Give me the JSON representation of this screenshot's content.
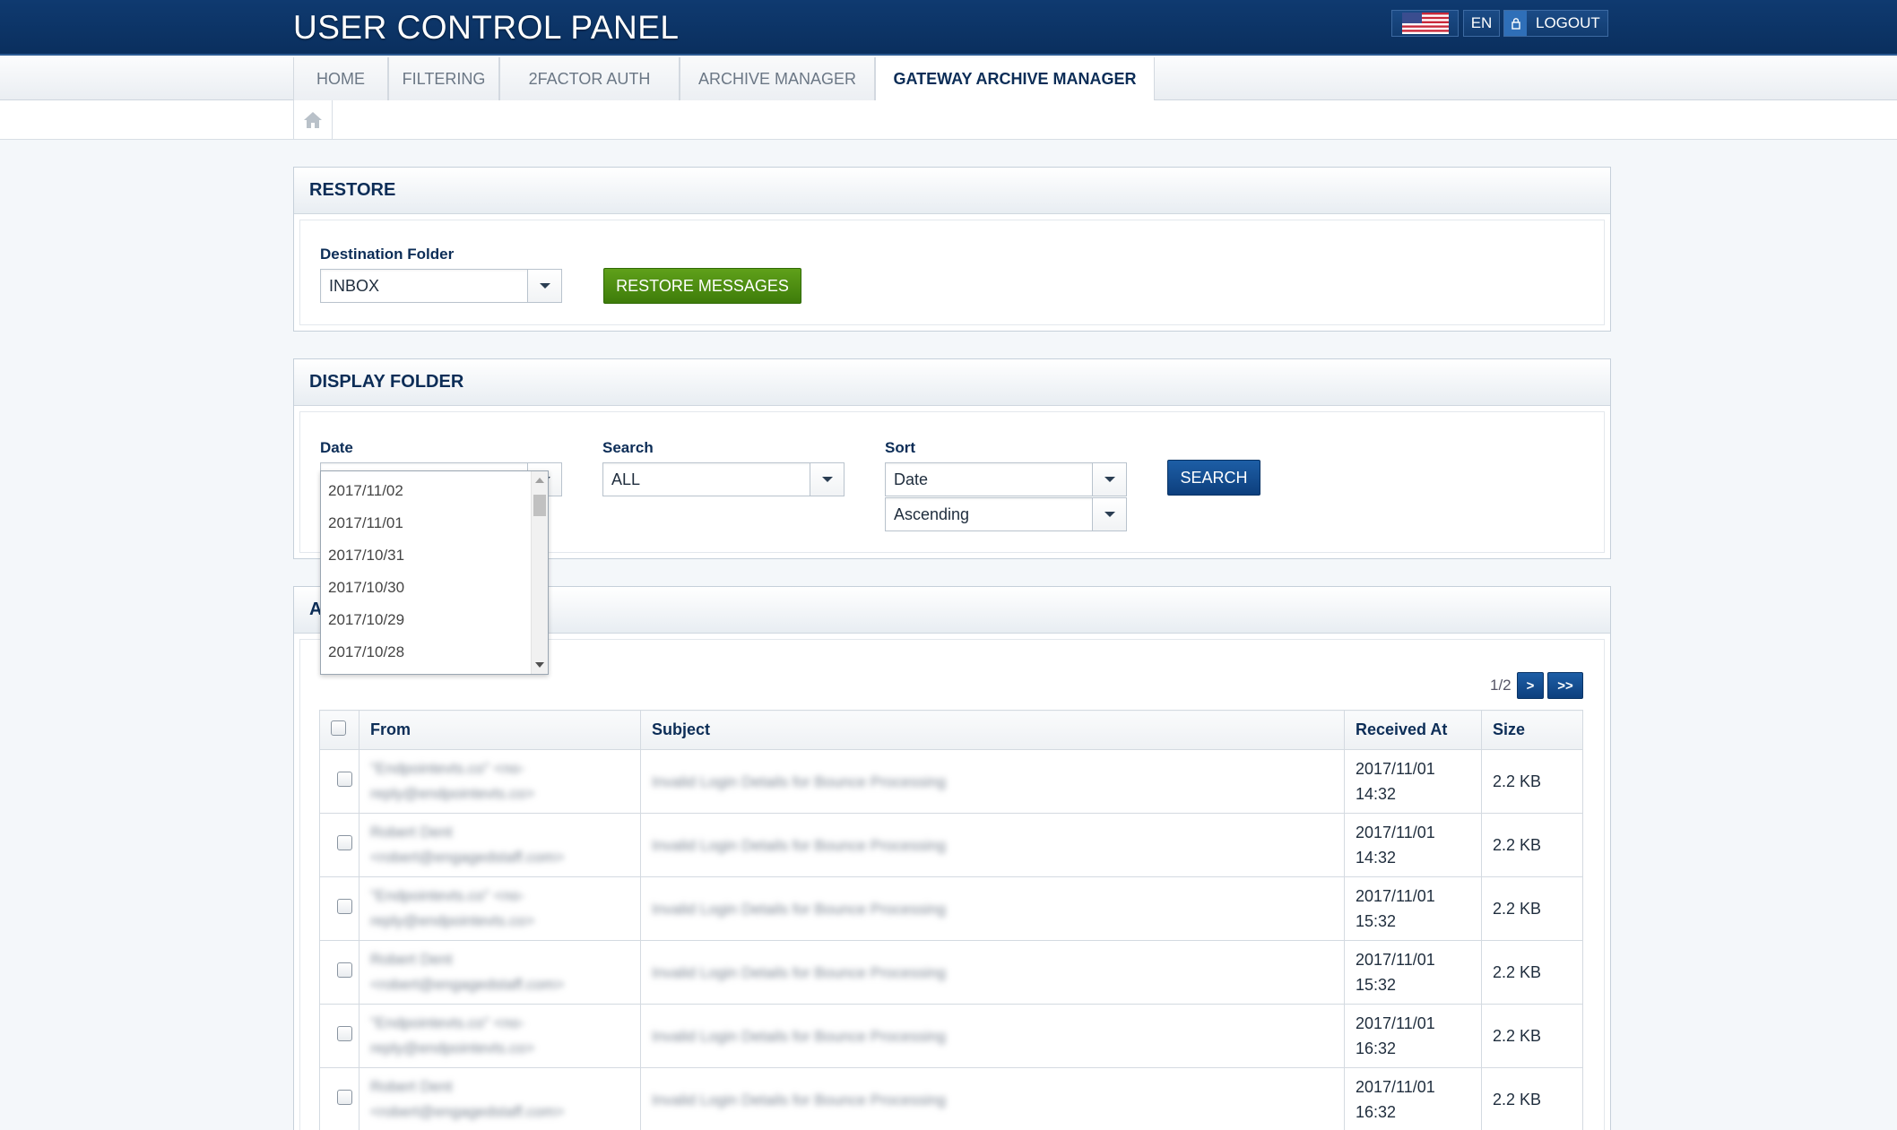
{
  "header": {
    "title": "USER CONTROL PANEL",
    "language": "EN",
    "logout_label": "LOGOUT"
  },
  "nav": {
    "tabs": [
      {
        "label": "HOME"
      },
      {
        "label": "FILTERING"
      },
      {
        "label": "2FACTOR AUTH"
      },
      {
        "label": "ARCHIVE MANAGER"
      },
      {
        "label": "GATEWAY ARCHIVE MANAGER"
      }
    ],
    "active_tab": "GATEWAY ARCHIVE MANAGER"
  },
  "restore": {
    "title": "RESTORE",
    "destination_label": "Destination Folder",
    "destination_value": "INBOX",
    "restore_button": "RESTORE MESSAGES"
  },
  "display": {
    "title": "DISPLAY FOLDER",
    "date_label": "Date",
    "search_label": "Search",
    "search_value": "ALL",
    "sort_label": "Sort",
    "sort_value": "Date",
    "order_value": "Ascending",
    "search_button": "SEARCH",
    "date_options": [
      "2017/11/02",
      "2017/11/01",
      "2017/10/31",
      "2017/10/30",
      "2017/10/29",
      "2017/10/28"
    ]
  },
  "archive": {
    "title_partial": "A",
    "pager_text": "1/2",
    "next_label": ">",
    "last_label": ">>",
    "columns": {
      "from": "From",
      "subject": "Subject",
      "received": "Received At",
      "size": "Size"
    },
    "rows": [
      {
        "from_1": "\"Endpointevts.co\" <no-",
        "from_2": "reply@endpointevts.co>",
        "subject": "Invalid Login Details for Bounce Processing",
        "date": "2017/11/01",
        "time": "14:32",
        "size": "2.2 KB"
      },
      {
        "from_1": "Robert Dent",
        "from_2": "<robert@engagedstaff.com>",
        "subject": "Invalid Login Details for Bounce Processing",
        "date": "2017/11/01",
        "time": "14:32",
        "size": "2.2 KB"
      },
      {
        "from_1": "\"Endpointevts.co\" <no-",
        "from_2": "reply@endpointevts.co>",
        "subject": "Invalid Login Details for Bounce Processing",
        "date": "2017/11/01",
        "time": "15:32",
        "size": "2.2 KB"
      },
      {
        "from_1": "Robert Dent",
        "from_2": "<robert@engagedstaff.com>",
        "subject": "Invalid Login Details for Bounce Processing",
        "date": "2017/11/01",
        "time": "15:32",
        "size": "2.2 KB"
      },
      {
        "from_1": "\"Endpointevts.co\" <no-",
        "from_2": "reply@endpointevts.co>",
        "subject": "Invalid Login Details for Bounce Processing",
        "date": "2017/11/01",
        "time": "16:32",
        "size": "2.2 KB"
      },
      {
        "from_1": "Robert Dent",
        "from_2": "<robert@engagedstaff.com>",
        "subject": "Invalid Login Details for Bounce Processing",
        "date": "2017/11/01",
        "time": "16:32",
        "size": "2.2 KB"
      }
    ]
  },
  "icons": {
    "flag": "us-flag-icon",
    "lock": "lock-icon",
    "home": "home-icon",
    "caret": "caret-down-icon"
  }
}
